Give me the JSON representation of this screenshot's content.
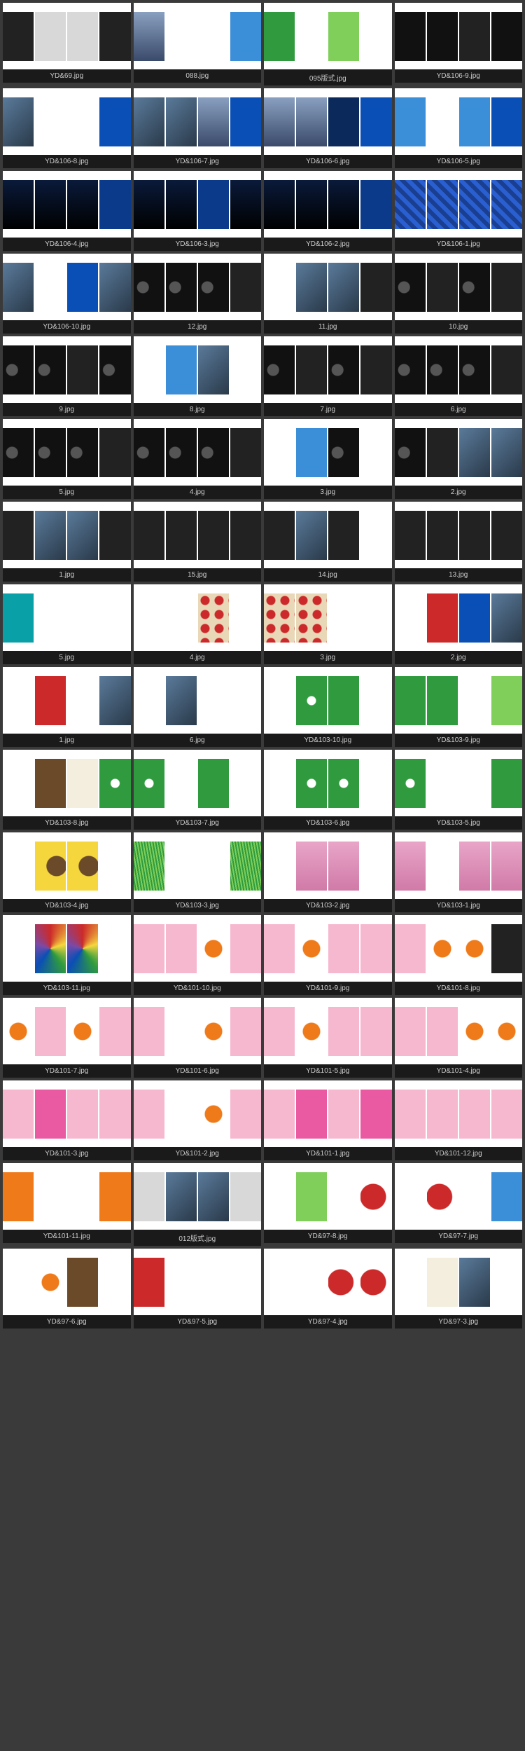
{
  "items": [
    {
      "label": "YD&69.jpg",
      "panels": [
        "c-dark",
        "c-lgrey",
        "c-lgrey",
        "c-dark"
      ]
    },
    {
      "label": "088.jpg",
      "panels": [
        "c-city",
        "c-white",
        "c-white",
        "c-lblue"
      ]
    },
    {
      "label": "095版式.jpg",
      "panels": [
        "c-green",
        "c-white",
        "c-lgreen",
        "c-white"
      ]
    },
    {
      "label": "YD&106-9.jpg",
      "panels": [
        "c-black",
        "c-black",
        "c-dark",
        "c-black"
      ]
    },
    {
      "label": "YD&106-8.jpg",
      "panels": [
        "c-photo",
        "c-white",
        "c-white",
        "c-blue"
      ]
    },
    {
      "label": "YD&106-7.jpg",
      "panels": [
        "c-photo",
        "c-photo",
        "c-city",
        "c-blue"
      ]
    },
    {
      "label": "YD&106-6.jpg",
      "panels": [
        "c-city",
        "c-city",
        "c-navy",
        "c-blue"
      ]
    },
    {
      "label": "YD&106-5.jpg",
      "panels": [
        "c-lblue",
        "c-white",
        "c-lblue",
        "c-blue"
      ]
    },
    {
      "label": "YD&106-4.jpg",
      "panels": [
        "c-night",
        "c-night",
        "c-night",
        "c-dblue"
      ]
    },
    {
      "label": "YD&106-3.jpg",
      "panels": [
        "c-night",
        "c-night",
        "c-dblue",
        "c-night"
      ]
    },
    {
      "label": "YD&106-2.jpg",
      "panels": [
        "c-night",
        "c-night",
        "c-night",
        "c-dblue"
      ]
    },
    {
      "label": "YD&106-1.jpg",
      "panels": [
        "c-sq",
        "c-sq",
        "c-sq",
        "c-sq"
      ]
    },
    {
      "label": "YD&106-10.jpg",
      "panels": [
        "c-photo",
        "c-white",
        "c-blue",
        "c-photo"
      ]
    },
    {
      "label": "12.jpg",
      "panels": [
        "c-bike",
        "c-bike",
        "c-bike",
        "c-dark"
      ]
    },
    {
      "label": "11.jpg",
      "panels": [
        "c-white",
        "c-photo",
        "c-photo",
        "c-dark"
      ]
    },
    {
      "label": "10.jpg",
      "panels": [
        "c-bike",
        "c-dark",
        "c-bike",
        "c-dark"
      ]
    },
    {
      "label": "9.jpg",
      "panels": [
        "c-bike",
        "c-bike",
        "c-dark",
        "c-bike"
      ]
    },
    {
      "label": "8.jpg",
      "panels": [
        "c-white",
        "c-lblue",
        "c-photo",
        "c-white"
      ]
    },
    {
      "label": "7.jpg",
      "panels": [
        "c-bike",
        "c-dark",
        "c-bike",
        "c-dark"
      ]
    },
    {
      "label": "6.jpg",
      "panels": [
        "c-bike",
        "c-bike",
        "c-bike",
        "c-dark"
      ]
    },
    {
      "label": "5.jpg",
      "panels": [
        "c-bike",
        "c-bike",
        "c-bike",
        "c-dark"
      ]
    },
    {
      "label": "4.jpg",
      "panels": [
        "c-bike",
        "c-bike",
        "c-bike",
        "c-dark"
      ]
    },
    {
      "label": "3.jpg",
      "panels": [
        "c-white",
        "c-lblue",
        "c-bike",
        "c-white"
      ]
    },
    {
      "label": "2.jpg",
      "panels": [
        "c-bike",
        "c-dark",
        "c-photo",
        "c-photo"
      ]
    },
    {
      "label": "1.jpg",
      "panels": [
        "c-dark",
        "c-photo",
        "c-photo",
        "c-dark"
      ]
    },
    {
      "label": "15.jpg",
      "panels": [
        "c-dark",
        "c-dark",
        "c-dark",
        "c-dark"
      ]
    },
    {
      "label": "14.jpg",
      "panels": [
        "c-dark",
        "c-photo",
        "c-dark",
        "c-white"
      ]
    },
    {
      "label": "13.jpg",
      "panels": [
        "c-dark",
        "c-dark",
        "c-dark",
        "c-dark"
      ]
    },
    {
      "label": "5.jpg",
      "panels": [
        "c-teal",
        "c-white",
        "c-white",
        "c-white"
      ]
    },
    {
      "label": "4.jpg",
      "panels": [
        "c-white",
        "c-white",
        "c-pat",
        "c-white"
      ]
    },
    {
      "label": "3.jpg",
      "panels": [
        "c-pat",
        "c-pat",
        "c-white",
        "c-white"
      ]
    },
    {
      "label": "2.jpg",
      "panels": [
        "c-white",
        "c-red",
        "c-blue",
        "c-photo"
      ]
    },
    {
      "label": "1.jpg",
      "panels": [
        "c-white",
        "c-red",
        "c-white",
        "c-photo"
      ]
    },
    {
      "label": "6.jpg",
      "panels": [
        "c-white",
        "c-photo",
        "c-white",
        "c-white"
      ]
    },
    {
      "label": "YD&103-10.jpg",
      "panels": [
        "c-white",
        "c-flower",
        "c-green",
        "c-white"
      ]
    },
    {
      "label": "YD&103-9.jpg",
      "panels": [
        "c-green",
        "c-green",
        "c-white",
        "c-lgreen"
      ]
    },
    {
      "label": "YD&103-8.jpg",
      "panels": [
        "c-white",
        "c-brown",
        "c-cream",
        "c-flower"
      ]
    },
    {
      "label": "YD&103-7.jpg",
      "panels": [
        "c-flower",
        "c-white",
        "c-green",
        "c-white"
      ]
    },
    {
      "label": "YD&103-6.jpg",
      "panels": [
        "c-white",
        "c-flower",
        "c-flower",
        "c-white"
      ]
    },
    {
      "label": "YD&103-5.jpg",
      "panels": [
        "c-flower",
        "c-white",
        "c-white",
        "c-green"
      ]
    },
    {
      "label": "YD&103-4.jpg",
      "panels": [
        "c-white",
        "c-sun",
        "c-sun",
        "c-white"
      ]
    },
    {
      "label": "YD&103-3.jpg",
      "panels": [
        "c-grass",
        "c-white",
        "c-white",
        "c-grass"
      ]
    },
    {
      "label": "YD&103-2.jpg",
      "panels": [
        "c-white",
        "c-blossom",
        "c-blossom",
        "c-white"
      ]
    },
    {
      "label": "YD&103-1.jpg",
      "panels": [
        "c-blossom",
        "c-white",
        "c-blossom",
        "c-blossom"
      ]
    },
    {
      "label": "YD&103-11.jpg",
      "panels": [
        "c-white",
        "c-pencil",
        "c-pencil",
        "c-white"
      ]
    },
    {
      "label": "YD&101-10.jpg",
      "panels": [
        "c-pink",
        "c-pink",
        "c-food",
        "c-pink"
      ]
    },
    {
      "label": "YD&101-9.jpg",
      "panels": [
        "c-pink",
        "c-food",
        "c-pink",
        "c-pink"
      ]
    },
    {
      "label": "YD&101-8.jpg",
      "panels": [
        "c-pink",
        "c-food",
        "c-food",
        "c-dark"
      ]
    },
    {
      "label": "YD&101-7.jpg",
      "panels": [
        "c-food",
        "c-pink",
        "c-food",
        "c-pink"
      ]
    },
    {
      "label": "YD&101-6.jpg",
      "panels": [
        "c-pink",
        "c-white",
        "c-food",
        "c-pink"
      ]
    },
    {
      "label": "YD&101-5.jpg",
      "panels": [
        "c-pink",
        "c-food",
        "c-pink",
        "c-pink"
      ]
    },
    {
      "label": "YD&101-4.jpg",
      "panels": [
        "c-pink",
        "c-pink",
        "c-food",
        "c-food"
      ]
    },
    {
      "label": "YD&101-3.jpg",
      "panels": [
        "c-pink",
        "c-hotpink",
        "c-pink",
        "c-pink"
      ]
    },
    {
      "label": "YD&101-2.jpg",
      "panels": [
        "c-pink",
        "c-white",
        "c-food",
        "c-pink"
      ]
    },
    {
      "label": "YD&101-1.jpg",
      "panels": [
        "c-pink",
        "c-hotpink",
        "c-pink",
        "c-hotpink"
      ]
    },
    {
      "label": "YD&101-12.jpg",
      "panels": [
        "c-pink",
        "c-pink",
        "c-pink",
        "c-pink"
      ]
    },
    {
      "label": "YD&101-11.jpg",
      "panels": [
        "c-orange",
        "c-white",
        "c-white",
        "c-orange"
      ]
    },
    {
      "label": "012版式.jpg",
      "panels": [
        "c-lgrey",
        "c-photo",
        "c-photo",
        "c-lgrey"
      ]
    },
    {
      "label": "YD&97-8.jpg",
      "panels": [
        "c-white",
        "c-lgreen",
        "c-white",
        "c-berry"
      ]
    },
    {
      "label": "YD&97-7.jpg",
      "panels": [
        "c-white",
        "c-berry",
        "c-white",
        "c-lblue"
      ]
    },
    {
      "label": "YD&97-6.jpg",
      "panels": [
        "c-white",
        "c-food",
        "c-brown",
        "c-white"
      ]
    },
    {
      "label": "YD&97-5.jpg",
      "panels": [
        "c-red",
        "c-white",
        "c-white",
        "c-white"
      ]
    },
    {
      "label": "YD&97-4.jpg",
      "panels": [
        "c-white",
        "c-white",
        "c-berry",
        "c-berry"
      ]
    },
    {
      "label": "YD&97-3.jpg",
      "panels": [
        "c-white",
        "c-cream",
        "c-photo",
        "c-white"
      ]
    }
  ]
}
